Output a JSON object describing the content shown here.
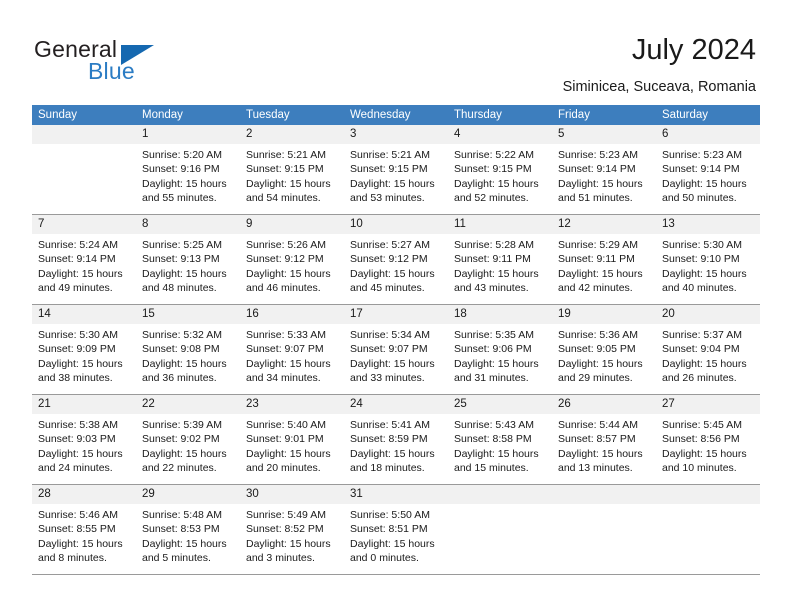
{
  "brand": {
    "name_part1": "General",
    "name_part2": "Blue",
    "accent_color": "#2b7cc4",
    "triangle_color": "#1568b0"
  },
  "header": {
    "title": "July 2024",
    "subtitle": "Siminicea, Suceava, Romania"
  },
  "calendar": {
    "header_color": "#3d7ebe",
    "daynum_band_color": "#f1f1f1",
    "weekdays": [
      "Sunday",
      "Monday",
      "Tuesday",
      "Wednesday",
      "Thursday",
      "Friday",
      "Saturday"
    ],
    "weeks": [
      [
        {
          "day": "",
          "sunrise": "",
          "sunset": "",
          "daylight_line1": "",
          "daylight_line2": ""
        },
        {
          "day": "1",
          "sunrise": "Sunrise: 5:20 AM",
          "sunset": "Sunset: 9:16 PM",
          "daylight_line1": "Daylight: 15 hours",
          "daylight_line2": "and 55 minutes."
        },
        {
          "day": "2",
          "sunrise": "Sunrise: 5:21 AM",
          "sunset": "Sunset: 9:15 PM",
          "daylight_line1": "Daylight: 15 hours",
          "daylight_line2": "and 54 minutes."
        },
        {
          "day": "3",
          "sunrise": "Sunrise: 5:21 AM",
          "sunset": "Sunset: 9:15 PM",
          "daylight_line1": "Daylight: 15 hours",
          "daylight_line2": "and 53 minutes."
        },
        {
          "day": "4",
          "sunrise": "Sunrise: 5:22 AM",
          "sunset": "Sunset: 9:15 PM",
          "daylight_line1": "Daylight: 15 hours",
          "daylight_line2": "and 52 minutes."
        },
        {
          "day": "5",
          "sunrise": "Sunrise: 5:23 AM",
          "sunset": "Sunset: 9:14 PM",
          "daylight_line1": "Daylight: 15 hours",
          "daylight_line2": "and 51 minutes."
        },
        {
          "day": "6",
          "sunrise": "Sunrise: 5:23 AM",
          "sunset": "Sunset: 9:14 PM",
          "daylight_line1": "Daylight: 15 hours",
          "daylight_line2": "and 50 minutes."
        }
      ],
      [
        {
          "day": "7",
          "sunrise": "Sunrise: 5:24 AM",
          "sunset": "Sunset: 9:14 PM",
          "daylight_line1": "Daylight: 15 hours",
          "daylight_line2": "and 49 minutes."
        },
        {
          "day": "8",
          "sunrise": "Sunrise: 5:25 AM",
          "sunset": "Sunset: 9:13 PM",
          "daylight_line1": "Daylight: 15 hours",
          "daylight_line2": "and 48 minutes."
        },
        {
          "day": "9",
          "sunrise": "Sunrise: 5:26 AM",
          "sunset": "Sunset: 9:12 PM",
          "daylight_line1": "Daylight: 15 hours",
          "daylight_line2": "and 46 minutes."
        },
        {
          "day": "10",
          "sunrise": "Sunrise: 5:27 AM",
          "sunset": "Sunset: 9:12 PM",
          "daylight_line1": "Daylight: 15 hours",
          "daylight_line2": "and 45 minutes."
        },
        {
          "day": "11",
          "sunrise": "Sunrise: 5:28 AM",
          "sunset": "Sunset: 9:11 PM",
          "daylight_line1": "Daylight: 15 hours",
          "daylight_line2": "and 43 minutes."
        },
        {
          "day": "12",
          "sunrise": "Sunrise: 5:29 AM",
          "sunset": "Sunset: 9:11 PM",
          "daylight_line1": "Daylight: 15 hours",
          "daylight_line2": "and 42 minutes."
        },
        {
          "day": "13",
          "sunrise": "Sunrise: 5:30 AM",
          "sunset": "Sunset: 9:10 PM",
          "daylight_line1": "Daylight: 15 hours",
          "daylight_line2": "and 40 minutes."
        }
      ],
      [
        {
          "day": "14",
          "sunrise": "Sunrise: 5:30 AM",
          "sunset": "Sunset: 9:09 PM",
          "daylight_line1": "Daylight: 15 hours",
          "daylight_line2": "and 38 minutes."
        },
        {
          "day": "15",
          "sunrise": "Sunrise: 5:32 AM",
          "sunset": "Sunset: 9:08 PM",
          "daylight_line1": "Daylight: 15 hours",
          "daylight_line2": "and 36 minutes."
        },
        {
          "day": "16",
          "sunrise": "Sunrise: 5:33 AM",
          "sunset": "Sunset: 9:07 PM",
          "daylight_line1": "Daylight: 15 hours",
          "daylight_line2": "and 34 minutes."
        },
        {
          "day": "17",
          "sunrise": "Sunrise: 5:34 AM",
          "sunset": "Sunset: 9:07 PM",
          "daylight_line1": "Daylight: 15 hours",
          "daylight_line2": "and 33 minutes."
        },
        {
          "day": "18",
          "sunrise": "Sunrise: 5:35 AM",
          "sunset": "Sunset: 9:06 PM",
          "daylight_line1": "Daylight: 15 hours",
          "daylight_line2": "and 31 minutes."
        },
        {
          "day": "19",
          "sunrise": "Sunrise: 5:36 AM",
          "sunset": "Sunset: 9:05 PM",
          "daylight_line1": "Daylight: 15 hours",
          "daylight_line2": "and 29 minutes."
        },
        {
          "day": "20",
          "sunrise": "Sunrise: 5:37 AM",
          "sunset": "Sunset: 9:04 PM",
          "daylight_line1": "Daylight: 15 hours",
          "daylight_line2": "and 26 minutes."
        }
      ],
      [
        {
          "day": "21",
          "sunrise": "Sunrise: 5:38 AM",
          "sunset": "Sunset: 9:03 PM",
          "daylight_line1": "Daylight: 15 hours",
          "daylight_line2": "and 24 minutes."
        },
        {
          "day": "22",
          "sunrise": "Sunrise: 5:39 AM",
          "sunset": "Sunset: 9:02 PM",
          "daylight_line1": "Daylight: 15 hours",
          "daylight_line2": "and 22 minutes."
        },
        {
          "day": "23",
          "sunrise": "Sunrise: 5:40 AM",
          "sunset": "Sunset: 9:01 PM",
          "daylight_line1": "Daylight: 15 hours",
          "daylight_line2": "and 20 minutes."
        },
        {
          "day": "24",
          "sunrise": "Sunrise: 5:41 AM",
          "sunset": "Sunset: 8:59 PM",
          "daylight_line1": "Daylight: 15 hours",
          "daylight_line2": "and 18 minutes."
        },
        {
          "day": "25",
          "sunrise": "Sunrise: 5:43 AM",
          "sunset": "Sunset: 8:58 PM",
          "daylight_line1": "Daylight: 15 hours",
          "daylight_line2": "and 15 minutes."
        },
        {
          "day": "26",
          "sunrise": "Sunrise: 5:44 AM",
          "sunset": "Sunset: 8:57 PM",
          "daylight_line1": "Daylight: 15 hours",
          "daylight_line2": "and 13 minutes."
        },
        {
          "day": "27",
          "sunrise": "Sunrise: 5:45 AM",
          "sunset": "Sunset: 8:56 PM",
          "daylight_line1": "Daylight: 15 hours",
          "daylight_line2": "and 10 minutes."
        }
      ],
      [
        {
          "day": "28",
          "sunrise": "Sunrise: 5:46 AM",
          "sunset": "Sunset: 8:55 PM",
          "daylight_line1": "Daylight: 15 hours",
          "daylight_line2": "and 8 minutes."
        },
        {
          "day": "29",
          "sunrise": "Sunrise: 5:48 AM",
          "sunset": "Sunset: 8:53 PM",
          "daylight_line1": "Daylight: 15 hours",
          "daylight_line2": "and 5 minutes."
        },
        {
          "day": "30",
          "sunrise": "Sunrise: 5:49 AM",
          "sunset": "Sunset: 8:52 PM",
          "daylight_line1": "Daylight: 15 hours",
          "daylight_line2": "and 3 minutes."
        },
        {
          "day": "31",
          "sunrise": "Sunrise: 5:50 AM",
          "sunset": "Sunset: 8:51 PM",
          "daylight_line1": "Daylight: 15 hours",
          "daylight_line2": "and 0 minutes."
        },
        {
          "day": "",
          "sunrise": "",
          "sunset": "",
          "daylight_line1": "",
          "daylight_line2": ""
        },
        {
          "day": "",
          "sunrise": "",
          "sunset": "",
          "daylight_line1": "",
          "daylight_line2": ""
        },
        {
          "day": "",
          "sunrise": "",
          "sunset": "",
          "daylight_line1": "",
          "daylight_line2": ""
        }
      ]
    ]
  }
}
